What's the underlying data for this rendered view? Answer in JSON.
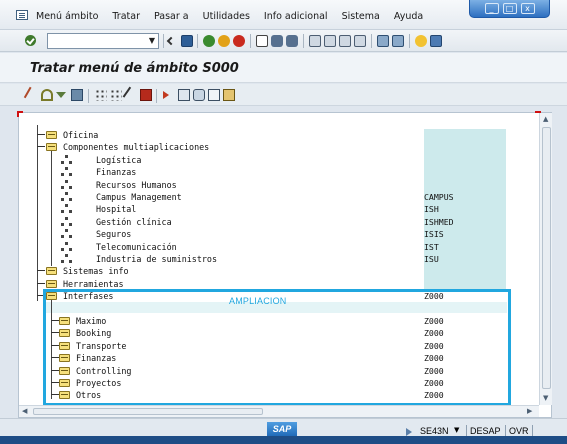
{
  "menu": {
    "items": [
      {
        "label": "Menú ámbito"
      },
      {
        "label": "Tratar"
      },
      {
        "label": "Pasar a"
      },
      {
        "label": "Utilidades"
      },
      {
        "label": "Info adicional"
      },
      {
        "label": "Sistema"
      },
      {
        "label": "Ayuda"
      }
    ]
  },
  "window_controls": {
    "minimize": "_",
    "maximize": "□",
    "close": "x"
  },
  "toolbar": {
    "command_field_value": ""
  },
  "title": "Tratar menú de ámbito S000",
  "tree": {
    "annotation": "AMPLIACION",
    "nodes": [
      {
        "label": "Oficina",
        "value": ""
      },
      {
        "label": "Componentes multiaplicaciones",
        "value": ""
      },
      {
        "label": "Logística",
        "value": ""
      },
      {
        "label": "Finanzas",
        "value": ""
      },
      {
        "label": "Recursos Humanos",
        "value": ""
      },
      {
        "label": "Campus Management",
        "value": "CAMPUS"
      },
      {
        "label": "Hospital",
        "value": "ISH"
      },
      {
        "label": "Gestión clínica",
        "value": "ISHMED"
      },
      {
        "label": "Seguros",
        "value": "ISIS"
      },
      {
        "label": "Telecomunicación",
        "value": "IST"
      },
      {
        "label": "Industria de suministros",
        "value": "ISU"
      },
      {
        "label": "Sistemas info",
        "value": ""
      },
      {
        "label": "Herramientas",
        "value": ""
      },
      {
        "label": "Interfases",
        "value": "Z000"
      },
      {
        "label": "",
        "value": ""
      },
      {
        "label": "Maximo",
        "value": "Z000"
      },
      {
        "label": "Booking",
        "value": "Z000"
      },
      {
        "label": "Transporte",
        "value": "Z000"
      },
      {
        "label": "Finanzas",
        "value": "Z000"
      },
      {
        "label": "Controlling",
        "value": "Z000"
      },
      {
        "label": "Proyectos",
        "value": "Z000"
      },
      {
        "label": "Otros",
        "value": "Z000"
      }
    ]
  },
  "status": {
    "logo": "SAP",
    "tcode": "SE43N",
    "server": "DESAP",
    "mode": "OVR"
  },
  "colors": {
    "highlight": "#21a7df",
    "value_column": "#cdeaec"
  }
}
